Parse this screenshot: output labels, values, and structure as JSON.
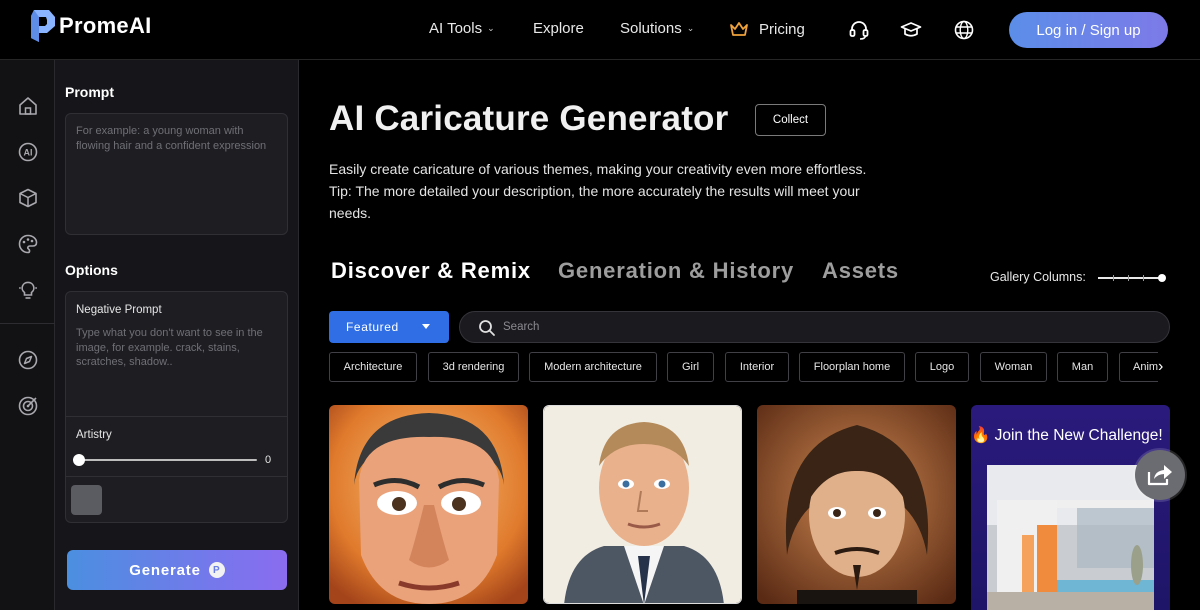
{
  "brand": {
    "name": "PromeAI"
  },
  "nav": {
    "ai_tools": "AI Tools",
    "explore": "Explore",
    "solutions": "Solutions",
    "pricing": "Pricing",
    "login": "Log in / Sign up"
  },
  "rail": {
    "icons": [
      "home-icon",
      "ai-icon",
      "cube-icon",
      "palette-icon",
      "lightbulb-icon",
      "compass-icon",
      "target-icon"
    ]
  },
  "panel": {
    "prompt_label": "Prompt",
    "prompt_placeholder": "For example: a young woman with flowing hair and a confident expression",
    "options_label": "Options",
    "negative_label": "Negative Prompt",
    "negative_placeholder": "Type what you don't want to see in the image, for example. crack, stains, scratches, shadow..",
    "artistry_label": "Artistry",
    "artistry_value": 0,
    "generate_label": "Generate",
    "generate_coin": "P"
  },
  "main": {
    "title": "AI Caricature Generator",
    "collect_label": "Collect",
    "description": "Easily create caricature of various themes, making your creativity even more effortless.",
    "tip": "Tip: The more detailed your description, the more accurately the results will meet your needs.",
    "tabs": [
      {
        "label": "Discover & Remix",
        "active": true
      },
      {
        "label": "Generation & History",
        "active": false
      },
      {
        "label": "Assets",
        "active": false
      }
    ],
    "gallery_columns_label": "Gallery Columns:",
    "featured_label": "Featured",
    "search_placeholder": "Search",
    "chips": [
      "Architecture",
      "3d rendering",
      "Modern architecture",
      "Girl",
      "Interior",
      "Floorplan home",
      "Logo",
      "Woman",
      "Man",
      "Anime"
    ],
    "challenge_text": "🔥 Join the New Challenge!"
  },
  "colors": {
    "accent_blue": "#2f6ee4",
    "login_gradient_start": "#5b8ee8",
    "login_gradient_end": "#7d7ae8",
    "challenge_bg": "#2a1a7c"
  }
}
